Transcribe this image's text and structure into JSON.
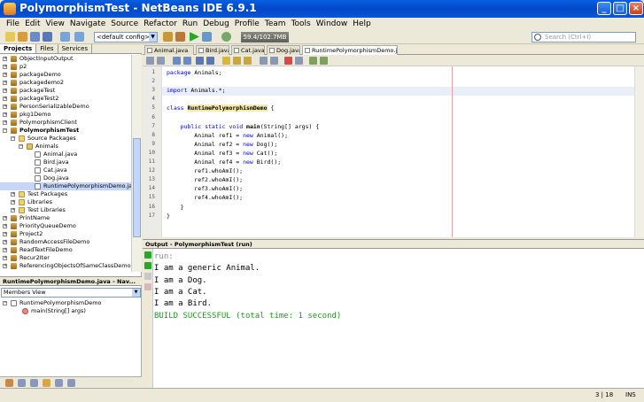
{
  "window": {
    "title": "PolymorphismTest - NetBeans IDE 6.9.1"
  },
  "menu": [
    "File",
    "Edit",
    "View",
    "Navigate",
    "Source",
    "Refactor",
    "Run",
    "Debug",
    "Profile",
    "Team",
    "Tools",
    "Window",
    "Help"
  ],
  "toolbar": {
    "config": "<default config>",
    "memory": "59.4/102.7MB",
    "search_placeholder": "Search (Ctrl+I)"
  },
  "panel_tabs": [
    "Projects",
    "Files",
    "Services"
  ],
  "tree": [
    {
      "label": "ObjectInputOutput",
      "level": 0,
      "icon": "proj"
    },
    {
      "label": "p2",
      "level": 0,
      "icon": "proj"
    },
    {
      "label": "packageDemo",
      "level": 0,
      "icon": "proj"
    },
    {
      "label": "packagedemo2",
      "level": 0,
      "icon": "proj"
    },
    {
      "label": "packageTest",
      "level": 0,
      "icon": "proj"
    },
    {
      "label": "packageTest2",
      "level": 0,
      "icon": "proj"
    },
    {
      "label": "PersonSerializableDemo",
      "level": 0,
      "icon": "proj"
    },
    {
      "label": "pkg1Demo",
      "level": 0,
      "icon": "proj"
    },
    {
      "label": "PolymorphismClient",
      "level": 0,
      "icon": "proj"
    },
    {
      "label": "PolymorphismTest",
      "level": 0,
      "icon": "proj",
      "bold": true,
      "open": true
    },
    {
      "label": "Source Packages",
      "level": 1,
      "icon": "folder",
      "open": true
    },
    {
      "label": "Animals",
      "level": 2,
      "icon": "pkg",
      "open": true
    },
    {
      "label": "Animal.java",
      "level": 3,
      "icon": "java"
    },
    {
      "label": "Bird.java",
      "level": 3,
      "icon": "java"
    },
    {
      "label": "Cat.java",
      "level": 3,
      "icon": "java"
    },
    {
      "label": "Dog.java",
      "level": 3,
      "icon": "java"
    },
    {
      "label": "RuntimePolymorphismDemo.java",
      "level": 3,
      "icon": "java",
      "selected": true
    },
    {
      "label": "Test Packages",
      "level": 1,
      "icon": "folder"
    },
    {
      "label": "Libraries",
      "level": 1,
      "icon": "folder"
    },
    {
      "label": "Test Libraries",
      "level": 1,
      "icon": "folder"
    },
    {
      "label": "PrintName",
      "level": 0,
      "icon": "proj"
    },
    {
      "label": "PriorityQueueDemo",
      "level": 0,
      "icon": "proj"
    },
    {
      "label": "Project2",
      "level": 0,
      "icon": "proj"
    },
    {
      "label": "RandomAccessFileDemo",
      "level": 0,
      "icon": "proj"
    },
    {
      "label": "ReadTextFileDemo",
      "level": 0,
      "icon": "proj"
    },
    {
      "label": "Recur2Iter",
      "level": 0,
      "icon": "proj"
    },
    {
      "label": "ReferencingObjectsOfSameClassDemo",
      "level": 0,
      "icon": "proj"
    }
  ],
  "navigator": {
    "title": "RuntimePolymorphismDemo.java - Nav...",
    "view": "Members View",
    "items": [
      {
        "label": "RuntimePolymorphismDemo",
        "level": 0
      },
      {
        "label": "main(String[] args)",
        "level": 1
      }
    ]
  },
  "editor_tabs": [
    "Animal.java",
    "Bird.java",
    "Cat.java",
    "Dog.java",
    "RuntimePolymorphismDemo.java"
  ],
  "code": [
    "package Animals;",
    "",
    "import Animals.*;",
    "",
    "class RuntimePolymorphismDemo {",
    "",
    "    public static void main(String[] args) {",
    "        Animal ref1 = new Animal();",
    "        Animal ref2 = new Dog();",
    "        Animal ref3 = new Cat();",
    "        Animal ref4 = new Bird();",
    "        ref1.whoAmI();",
    "        ref2.whoAmI();",
    "        ref3.whoAmI();",
    "        ref4.whoAmI();",
    "    }",
    "}"
  ],
  "output": {
    "title": "Output - PolymorphismTest (run)",
    "lines": [
      {
        "text": "run:",
        "color": "#8a8a8a"
      },
      {
        "text": "I am a generic Animal.",
        "color": "#000000"
      },
      {
        "text": "I am a Dog.",
        "color": "#000000"
      },
      {
        "text": "I am a Cat.",
        "color": "#000000"
      },
      {
        "text": "I am a Bird.",
        "color": "#000000"
      },
      {
        "text": "BUILD SUCCESSFUL (total time: 1 second)",
        "color": "#1e9a1e"
      }
    ]
  },
  "status": {
    "position": "3 | 18",
    "mode": "INS"
  },
  "colors": {
    "title_bar": "#0a5fe0",
    "keyword": "#0000e6",
    "success": "#1e9a1e"
  }
}
